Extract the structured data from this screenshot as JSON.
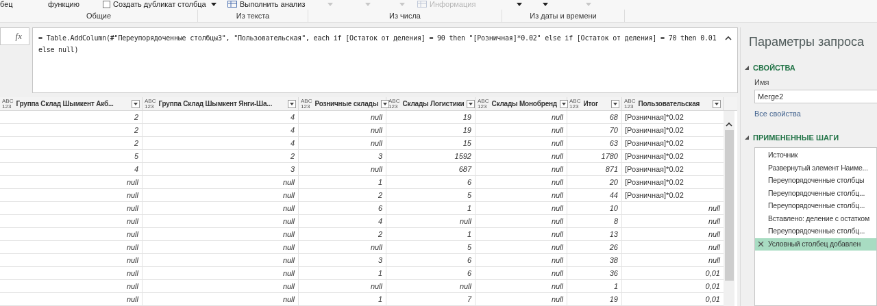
{
  "ribbon": {
    "items": [
      {
        "kind": "label",
        "text": "бец"
      },
      {
        "kind": "label",
        "text": "функцию"
      },
      {
        "kind": "checkbox",
        "text": "Создать дубликат столбца",
        "checked": false
      },
      {
        "kind": "caret",
        "disabled": false
      },
      {
        "kind": "action",
        "text": "Выполнить анализ",
        "disabled": false
      },
      {
        "kind": "caret",
        "disabled": true
      },
      {
        "kind": "caret",
        "disabled": true
      },
      {
        "kind": "caret",
        "disabled": true
      },
      {
        "kind": "action",
        "text": "Информация",
        "disabled": true
      },
      {
        "kind": "caret",
        "disabled": false
      },
      {
        "kind": "caret",
        "disabled": false
      },
      {
        "kind": "caret",
        "disabled": true
      }
    ],
    "groups": [
      "Общие",
      "Из текста",
      "Из числа",
      "Из даты и времени"
    ]
  },
  "formula_bar": {
    "fx": "fx",
    "formula": "= Table.AddColumn(#\"Переупорядоченные столбцы3\", \"Пользовательская\", each if [Остаток от деления] = 90 then \"[Розничная]*0.02\" else if [Остаток от деления] = 70 then 0.01 else null)"
  },
  "table": {
    "columns": [
      {
        "type": [
          "ABC",
          "123"
        ],
        "name": "Группа Склад Шымкент Акб..."
      },
      {
        "type": [
          "ABC",
          "123"
        ],
        "name": "Группа Склад Шымкент Янги-Ша..."
      },
      {
        "type": [
          "ABC",
          "123"
        ],
        "name": "Розничные склады"
      },
      {
        "type": [
          "ABC",
          "123"
        ],
        "name": "Склады Логистики"
      },
      {
        "type": [
          "ABC",
          "123"
        ],
        "name": "Склады Монобренд"
      },
      {
        "type": [
          "ABC",
          "123"
        ],
        "name": "Итог"
      },
      {
        "type": [
          "ABC",
          "123"
        ],
        "name": "Пользовательская"
      }
    ],
    "rows": [
      {
        "cells": [
          "2",
          "4",
          "null",
          "19",
          "null",
          "68"
        ],
        "custom": {
          "kind": "text",
          "value": "[Розничная]*0.02"
        }
      },
      {
        "cells": [
          "2",
          "4",
          "null",
          "19",
          "null",
          "70"
        ],
        "custom": {
          "kind": "text",
          "value": "[Розничная]*0.02"
        }
      },
      {
        "cells": [
          "2",
          "4",
          "null",
          "15",
          "null",
          "63"
        ],
        "custom": {
          "kind": "text",
          "value": "[Розничная]*0.02"
        }
      },
      {
        "cells": [
          "5",
          "2",
          "3",
          "1592",
          "null",
          "1780"
        ],
        "custom": {
          "kind": "text",
          "value": "[Розничная]*0.02"
        }
      },
      {
        "cells": [
          "4",
          "3",
          "null",
          "687",
          "null",
          "871"
        ],
        "custom": {
          "kind": "text",
          "value": "[Розничная]*0.02"
        }
      },
      {
        "cells": [
          "null",
          "null",
          "1",
          "6",
          "null",
          "20"
        ],
        "custom": {
          "kind": "text",
          "value": "[Розничная]*0.02"
        }
      },
      {
        "cells": [
          "null",
          "null",
          "2",
          "5",
          "null",
          "44"
        ],
        "custom": {
          "kind": "text",
          "value": "[Розничная]*0.02"
        }
      },
      {
        "cells": [
          "null",
          "null",
          "6",
          "1",
          "null",
          "10"
        ],
        "custom": {
          "kind": "number",
          "value": "null"
        }
      },
      {
        "cells": [
          "null",
          "null",
          "4",
          "null",
          "null",
          "8"
        ],
        "custom": {
          "kind": "number",
          "value": "null"
        }
      },
      {
        "cells": [
          "null",
          "null",
          "2",
          "1",
          "null",
          "13"
        ],
        "custom": {
          "kind": "number",
          "value": "null"
        }
      },
      {
        "cells": [
          "null",
          "null",
          "null",
          "5",
          "null",
          "26"
        ],
        "custom": {
          "kind": "number",
          "value": "null"
        }
      },
      {
        "cells": [
          "null",
          "null",
          "3",
          "6",
          "null",
          "38"
        ],
        "custom": {
          "kind": "number",
          "value": "null"
        }
      },
      {
        "cells": [
          "null",
          "null",
          "1",
          "6",
          "null",
          "36"
        ],
        "custom": {
          "kind": "number",
          "value": "0,01"
        }
      },
      {
        "cells": [
          "null",
          "null",
          "null",
          "null",
          "null",
          "1"
        ],
        "custom": {
          "kind": "number",
          "value": "0,01"
        }
      },
      {
        "cells": [
          "null",
          "null",
          "1",
          "7",
          "null",
          "19"
        ],
        "custom": {
          "kind": "number",
          "value": "0,01"
        }
      }
    ]
  },
  "query_settings": {
    "title": "Параметры запроса",
    "properties": {
      "heading": "СВОЙСТВА",
      "expanded": true,
      "name_label": "Имя",
      "name_value": "Merge2",
      "all_properties": "Все свойства"
    },
    "steps": {
      "heading": "ПРИМЕНЕННЫЕ ШАГИ",
      "expanded": true,
      "items": [
        {
          "label": "Источник",
          "selected": false
        },
        {
          "label": "Развернутый элемент Наиме...",
          "selected": false
        },
        {
          "label": "Переупорядоченные столбцы",
          "selected": false
        },
        {
          "label": "Переупорядоченные столбц...",
          "selected": false
        },
        {
          "label": "Переупорядоченные столбц...",
          "selected": false
        },
        {
          "label": "Вставлено: деление с остатком",
          "selected": false
        },
        {
          "label": "Переупорядоченные столбц...",
          "selected": false
        },
        {
          "label": "Условный столбец добавлен",
          "selected": true
        }
      ]
    }
  }
}
